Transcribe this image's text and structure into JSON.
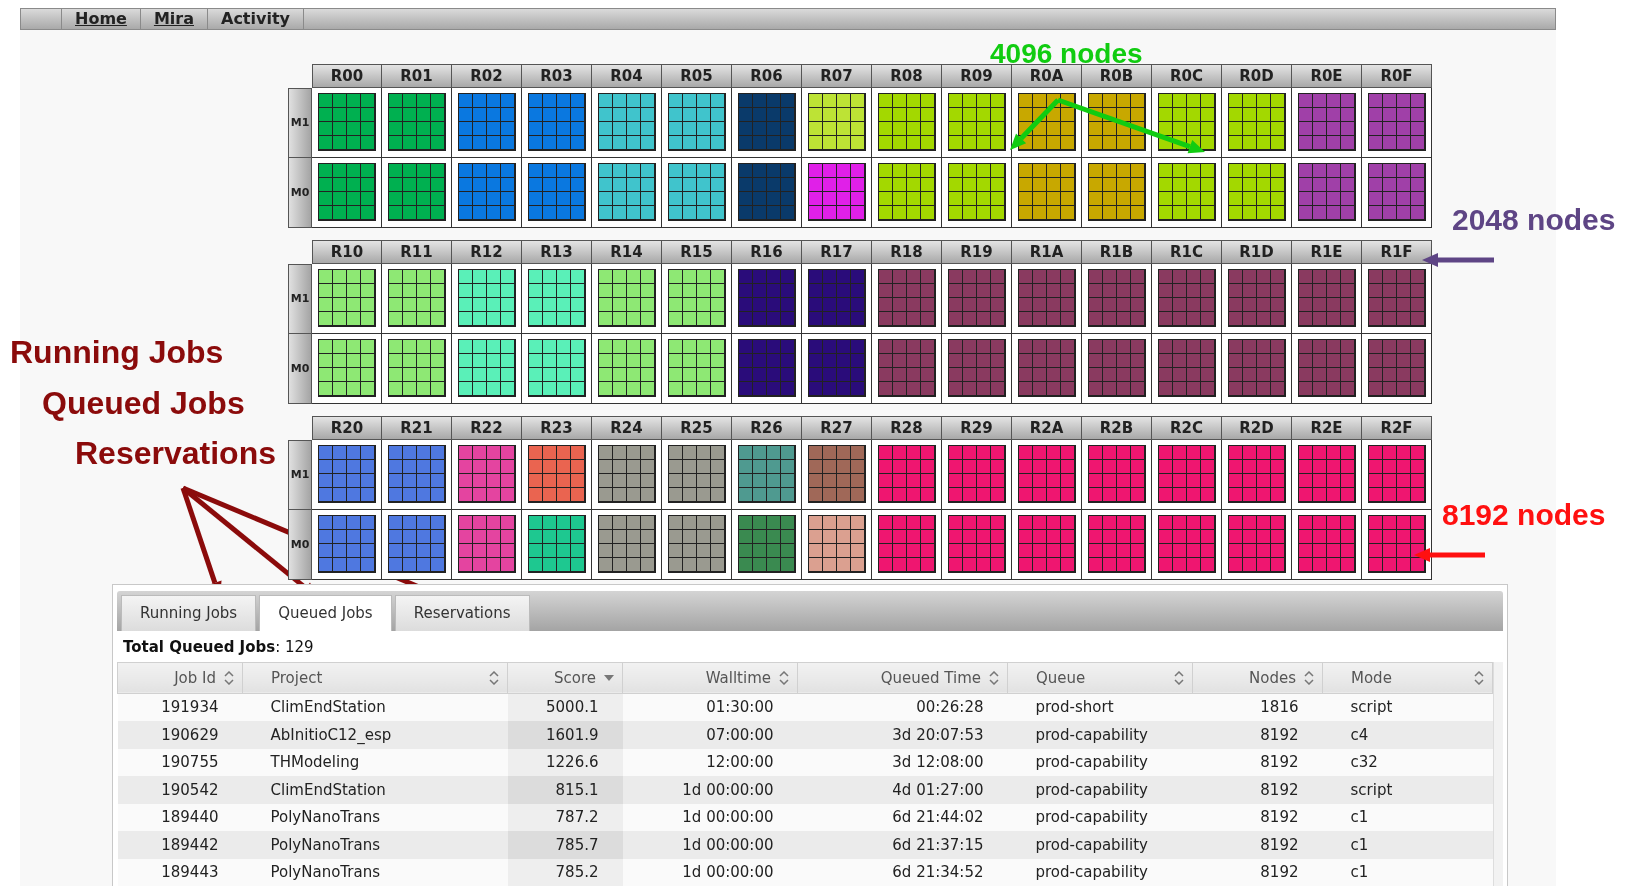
{
  "nav": {
    "items": [
      {
        "label": "Home",
        "kind": "link"
      },
      {
        "label": "Mira",
        "kind": "link"
      },
      {
        "label": "Activity",
        "kind": "text"
      }
    ]
  },
  "rack_rows": [
    {
      "midplane_labels": [
        "M1",
        "M0"
      ],
      "racks": [
        {
          "label": "R00",
          "midplanes": [
            {
              "color": "#00b050"
            },
            {
              "color": "#00b050"
            }
          ]
        },
        {
          "label": "R01",
          "midplanes": [
            {
              "color": "#00b050"
            },
            {
              "color": "#00b050"
            }
          ]
        },
        {
          "label": "R02",
          "midplanes": [
            {
              "color": "#0a78e0"
            },
            {
              "color": "#0a78e0"
            }
          ]
        },
        {
          "label": "R03",
          "midplanes": [
            {
              "color": "#0a78e0"
            },
            {
              "color": "#0a78e0"
            }
          ]
        },
        {
          "label": "R04",
          "midplanes": [
            {
              "color": "#40c4cc"
            },
            {
              "color": "#40c4cc"
            }
          ]
        },
        {
          "label": "R05",
          "midplanes": [
            {
              "color": "#40c4cc"
            },
            {
              "color": "#40c4cc"
            }
          ]
        },
        {
          "label": "R06",
          "midplanes": [
            {
              "color": "#0a3a6a"
            },
            {
              "color": "#0a3a6a"
            }
          ]
        },
        {
          "label": "R07",
          "midplanes": [
            {
              "color": "#bde335"
            },
            {
              "color": "#e020e8"
            }
          ]
        },
        {
          "label": "R08",
          "midplanes": [
            {
              "color": "#a3d800"
            },
            {
              "color": "#a3d800"
            }
          ]
        },
        {
          "label": "R09",
          "midplanes": [
            {
              "color": "#a3d800"
            },
            {
              "color": "#a3d800"
            }
          ]
        },
        {
          "label": "R0A",
          "midplanes": [
            {
              "color": "#c8a800"
            },
            {
              "color": "#c8a800"
            }
          ]
        },
        {
          "label": "R0B",
          "midplanes": [
            {
              "color": "#c8a800"
            },
            {
              "color": "#c8a800"
            }
          ]
        },
        {
          "label": "R0C",
          "midplanes": [
            {
              "color": "#a3d800"
            },
            {
              "color": "#a3d800"
            }
          ]
        },
        {
          "label": "R0D",
          "midplanes": [
            {
              "color": "#a3d800"
            },
            {
              "color": "#a3d800"
            }
          ]
        },
        {
          "label": "R0E",
          "midplanes": [
            {
              "color": "#a040a8"
            },
            {
              "color": "#a040a8"
            }
          ]
        },
        {
          "label": "R0F",
          "midplanes": [
            {
              "color": "#a040a8"
            },
            {
              "color": "#a040a8"
            }
          ]
        }
      ]
    },
    {
      "midplane_labels": [
        "M1",
        "M0"
      ],
      "racks": [
        {
          "label": "R10",
          "midplanes": [
            {
              "color": "#8ee874"
            },
            {
              "color": "#8ee874"
            }
          ]
        },
        {
          "label": "R11",
          "midplanes": [
            {
              "color": "#8ee874"
            },
            {
              "color": "#8ee874"
            }
          ]
        },
        {
          "label": "R12",
          "midplanes": [
            {
              "color": "#5af0b8"
            },
            {
              "color": "#5af0b8"
            }
          ]
        },
        {
          "label": "R13",
          "midplanes": [
            {
              "color": "#5af0b8"
            },
            {
              "color": "#5af0b8"
            }
          ]
        },
        {
          "label": "R14",
          "midplanes": [
            {
              "color": "#8ee874"
            },
            {
              "color": "#8ee874"
            }
          ]
        },
        {
          "label": "R15",
          "midplanes": [
            {
              "color": "#8ee874"
            },
            {
              "color": "#8ee874"
            }
          ]
        },
        {
          "label": "R16",
          "midplanes": [
            {
              "color": "#2a0c7a"
            },
            {
              "color": "#2a0c7a"
            }
          ]
        },
        {
          "label": "R17",
          "midplanes": [
            {
              "color": "#2a0c7a"
            },
            {
              "color": "#2a0c7a"
            }
          ]
        },
        {
          "label": "R18",
          "midplanes": [
            {
              "color": "#8a3a60"
            },
            {
              "color": "#8a3a60"
            }
          ]
        },
        {
          "label": "R19",
          "midplanes": [
            {
              "color": "#8a3a60"
            },
            {
              "color": "#8a3a60"
            }
          ]
        },
        {
          "label": "R1A",
          "midplanes": [
            {
              "color": "#8a3a60"
            },
            {
              "color": "#8a3a60"
            }
          ]
        },
        {
          "label": "R1B",
          "midplanes": [
            {
              "color": "#8a3a60"
            },
            {
              "color": "#8a3a60"
            }
          ]
        },
        {
          "label": "R1C",
          "midplanes": [
            {
              "color": "#8a3a60"
            },
            {
              "color": "#8a3a60"
            }
          ]
        },
        {
          "label": "R1D",
          "midplanes": [
            {
              "color": "#8a3a60"
            },
            {
              "color": "#8a3a60"
            }
          ]
        },
        {
          "label": "R1E",
          "midplanes": [
            {
              "color": "#8a3a60"
            },
            {
              "color": "#8a3a60"
            }
          ]
        },
        {
          "label": "R1F",
          "midplanes": [
            {
              "color": "#8a3a60"
            },
            {
              "color": "#8a3a60"
            }
          ]
        }
      ]
    },
    {
      "midplane_labels": [
        "M1",
        "M0"
      ],
      "racks": [
        {
          "label": "R20",
          "midplanes": [
            {
              "color": "#4f78e0"
            },
            {
              "color": "#4f78e0"
            }
          ]
        },
        {
          "label": "R21",
          "midplanes": [
            {
              "color": "#4f78e0"
            },
            {
              "color": "#4f78e0"
            }
          ]
        },
        {
          "label": "R22",
          "midplanes": [
            {
              "color": "#e444a0"
            },
            {
              "color": "#e444a0"
            }
          ]
        },
        {
          "label": "R23",
          "midplanes": [
            {
              "color": "#ea6450"
            },
            {
              "color": "#1ec890"
            }
          ]
        },
        {
          "label": "R24",
          "midplanes": [
            {
              "color": "#9a9a90"
            },
            {
              "color": "#9a9a90"
            }
          ]
        },
        {
          "label": "R25",
          "midplanes": [
            {
              "color": "#9a9a90"
            },
            {
              "color": "#9a9a90"
            }
          ]
        },
        {
          "label": "R26",
          "midplanes": [
            {
              "color": "#4f9a90"
            },
            {
              "color": "#3a8a50"
            }
          ]
        },
        {
          "label": "R27",
          "midplanes": [
            {
              "color": "#a06858"
            },
            {
              "color": "#dba090"
            }
          ]
        },
        {
          "label": "R28",
          "midplanes": [
            {
              "color": "#ef1670"
            },
            {
              "color": "#ef1670"
            }
          ]
        },
        {
          "label": "R29",
          "midplanes": [
            {
              "color": "#ef1670"
            },
            {
              "color": "#ef1670"
            }
          ]
        },
        {
          "label": "R2A",
          "midplanes": [
            {
              "color": "#ef1670"
            },
            {
              "color": "#ef1670"
            }
          ]
        },
        {
          "label": "R2B",
          "midplanes": [
            {
              "color": "#ef1670"
            },
            {
              "color": "#ef1670"
            }
          ]
        },
        {
          "label": "R2C",
          "midplanes": [
            {
              "color": "#ef1670"
            },
            {
              "color": "#ef1670"
            }
          ]
        },
        {
          "label": "R2D",
          "midplanes": [
            {
              "color": "#ef1670"
            },
            {
              "color": "#ef1670"
            }
          ]
        },
        {
          "label": "R2E",
          "midplanes": [
            {
              "color": "#ef1670"
            },
            {
              "color": "#ef1670"
            }
          ]
        },
        {
          "label": "R2F",
          "midplanes": [
            {
              "color": "#ef1670"
            },
            {
              "color": "#ef1670"
            }
          ]
        }
      ]
    }
  ],
  "tabs": [
    {
      "label": "Running Jobs",
      "selected": false
    },
    {
      "label": "Queued Jobs",
      "selected": true
    },
    {
      "label": "Reservations",
      "selected": false
    }
  ],
  "total": "**Total Queued Jobs**: 129",
  "table": {
    "columns": [
      {
        "label": "Job Id",
        "sorted": false
      },
      {
        "label": "Project",
        "sorted": false
      },
      {
        "label": "Score",
        "sorted": true
      },
      {
        "label": "Walltime",
        "sorted": false
      },
      {
        "label": "Queued Time",
        "sorted": false
      },
      {
        "label": "Queue",
        "sorted": false
      },
      {
        "label": "Nodes",
        "sorted": false
      },
      {
        "label": "Mode",
        "sorted": false
      }
    ],
    "rows": [
      [
        "191934",
        "ClimEndStation",
        "5000.1",
        "01:30:00",
        "00:26:28",
        "prod-short",
        "1816",
        "script"
      ],
      [
        "190629",
        "AbInitioC12_esp",
        "1601.9",
        "07:00:00",
        "3d 20:07:53",
        "prod-capability",
        "8192",
        "c4"
      ],
      [
        "190755",
        "THModeling",
        "1226.6",
        "12:00:00",
        "3d 12:08:00",
        "prod-capability",
        "8192",
        "c32"
      ],
      [
        "190542",
        "ClimEndStation",
        "815.1",
        "1d 00:00:00",
        "4d 01:27:00",
        "prod-capability",
        "8192",
        "script"
      ],
      [
        "189440",
        "PolyNanoTrans",
        "787.2",
        "1d 00:00:00",
        "6d 21:44:02",
        "prod-capability",
        "8192",
        "c1"
      ],
      [
        "189442",
        "PolyNanoTrans",
        "785.7",
        "1d 00:00:00",
        "6d 21:37:15",
        "prod-capability",
        "8192",
        "c1"
      ],
      [
        "189443",
        "PolyNanoTrans",
        "785.2",
        "1d 00:00:00",
        "6d 21:34:52",
        "prod-capability",
        "8192",
        "c1"
      ]
    ]
  },
  "annotations": [
    {
      "text": "Running Jobs",
      "color": "#8b0b0b"
    },
    {
      "text": "Queued Jobs",
      "color": "#8b0b0b"
    },
    {
      "text": "Reservations",
      "color": "#8b0b0b"
    },
    {
      "text": "4096 nodes",
      "color": "#11cc11"
    },
    {
      "text": "2048 nodes",
      "color": "#5e4585"
    },
    {
      "text": "8192 nodes",
      "color": "#ff1010"
    }
  ]
}
